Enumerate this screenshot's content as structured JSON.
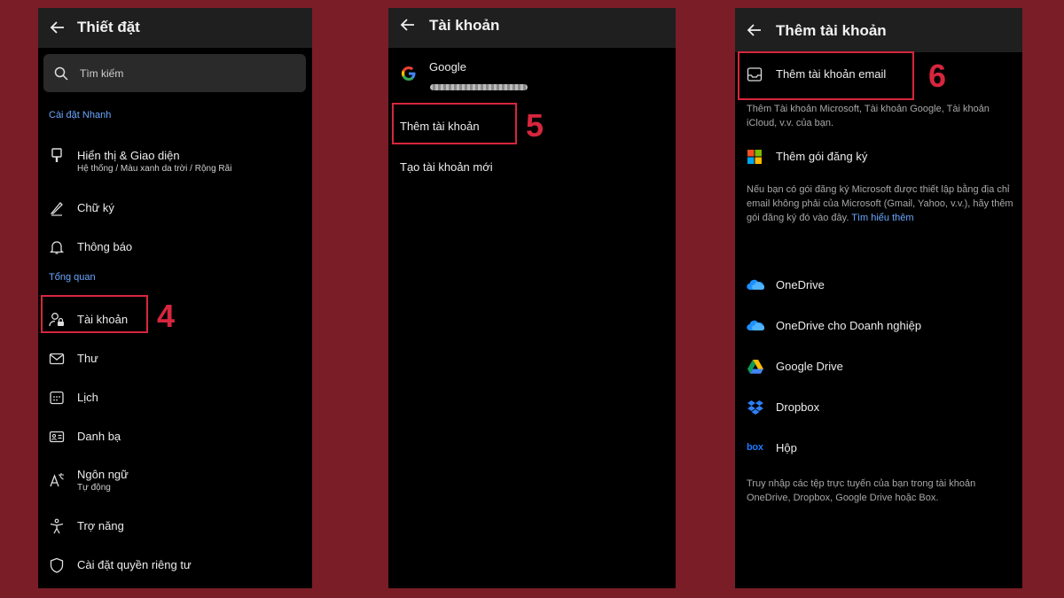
{
  "panel1": {
    "title": "Thiết đặt",
    "search_placeholder": "Tìm kiếm",
    "section_quick": "Cài đặt Nhanh",
    "section_overview": "Tổng quan",
    "items": [
      {
        "label": "Hiển thị & Giao diện",
        "sub": "Hệ thống / Màu xanh da trời / Rộng Rãi"
      },
      {
        "label": "Chữ ký"
      },
      {
        "label": "Thông báo"
      },
      {
        "label": "Tài khoản"
      },
      {
        "label": "Thư"
      },
      {
        "label": "Lịch"
      },
      {
        "label": "Danh bạ"
      },
      {
        "label": "Ngôn ngữ",
        "sub": "Tự động"
      },
      {
        "label": "Trợ năng"
      },
      {
        "label": "Cài đặt quyền riêng tư"
      }
    ],
    "step": "4"
  },
  "panel2": {
    "title": "Tài khoản",
    "account_name": "Google",
    "add_account": "Thêm tài khoản",
    "create_account": "Tạo tài khoản mới",
    "step": "5"
  },
  "panel3": {
    "title": "Thêm tài khoản",
    "add_email": "Thêm tài khoản email",
    "add_email_desc": "Thêm Tài khoản Microsoft, Tài khoản Google, Tài khoản iCloud, v.v. của bạn.",
    "add_subscription": "Thêm gói đăng ký",
    "subscription_desc": "Nếu bạn có gói đăng ký Microsoft được thiết lập bằng địa chỉ email không phải của Microsoft (Gmail, Yahoo, v.v.), hãy thêm gói đăng ký đó vào đây.",
    "learn_more": "Tìm hiểu thêm",
    "storage": [
      {
        "label": "OneDrive",
        "icon": "onedrive-icon"
      },
      {
        "label": "OneDrive cho Doanh nghiệp",
        "icon": "onedrive-icon"
      },
      {
        "label": "Google Drive",
        "icon": "google-drive-icon"
      },
      {
        "label": "Dropbox",
        "icon": "dropbox-icon"
      },
      {
        "label": "Hộp",
        "icon": "box-icon"
      }
    ],
    "box_logo": "box",
    "storage_desc": "Truy nhập các tệp trực tuyến của bạn trong tài khoản OneDrive, Dropbox, Google Drive hoặc Box.",
    "step": "6"
  },
  "colors": {
    "background": "#7a1d27",
    "highlight": "#d7263d",
    "accent": "#6aa7ff"
  }
}
